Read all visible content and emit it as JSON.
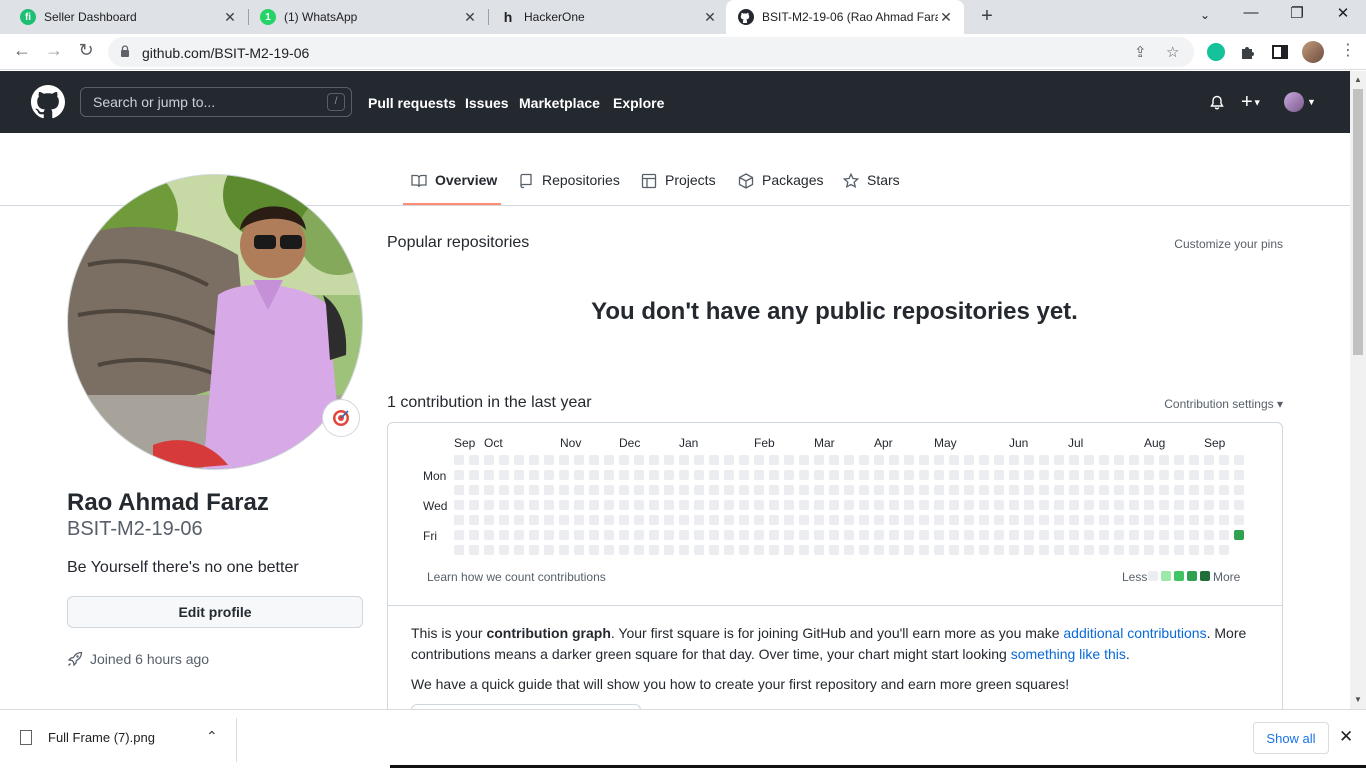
{
  "browser": {
    "tabs": [
      {
        "title": "Seller Dashboard",
        "favicon": "fiverr-icon",
        "color": "#1dbf73"
      },
      {
        "title": "(1) WhatsApp",
        "favicon": "whatsapp-icon",
        "color": "#25d366"
      },
      {
        "title": "HackerOne",
        "favicon": "hackerone-icon",
        "color": "#222222"
      },
      {
        "title": "BSIT-M2-19-06 (Rao Ahmad Faraz)",
        "favicon": "github-icon",
        "color": "#24292f",
        "active": true
      }
    ],
    "url": "github.com/BSIT-M2-19-06"
  },
  "github_header": {
    "search_placeholder": "Search or jump to...",
    "search_shortcut": "/",
    "nav": [
      "Pull requests",
      "Issues",
      "Marketplace",
      "Explore"
    ]
  },
  "profile_tabs": [
    "Overview",
    "Repositories",
    "Projects",
    "Packages",
    "Stars"
  ],
  "profile": {
    "name": "Rao Ahmad Faraz",
    "login": "BSIT-M2-19-06",
    "bio": "Be Yourself there's no one better",
    "edit_label": "Edit profile",
    "joined": "Joined 6 hours ago"
  },
  "overview": {
    "popular_title": "Popular repositories",
    "customize": "Customize your pins",
    "no_repos": "You don't have any public repositories yet.",
    "contrib_title": "1 contribution in the last year",
    "contrib_settings": "Contribution settings ▾",
    "months": [
      "Sep",
      "Oct",
      "Nov",
      "Dec",
      "Jan",
      "Feb",
      "Mar",
      "Apr",
      "May",
      "Jun",
      "Jul",
      "Aug",
      "Sep"
    ],
    "days": [
      "Mon",
      "Wed",
      "Fri"
    ],
    "weeks": 53,
    "contribution_day": {
      "week": 53,
      "weekday": "Fri",
      "count": 1
    },
    "learn_link": "Learn how we count contributions",
    "legend_less": "Less",
    "legend_more": "More",
    "legend_colors": [
      "#ebedf0",
      "#9be9a8",
      "#40c463",
      "#30a14e",
      "#216e39"
    ],
    "explain_1": "This is your ",
    "explain_bold": "contribution graph",
    "explain_2": ". Your first square is for joining GitHub and you'll earn more as you make ",
    "explain_link1": "additional contributions",
    "explain_3": ". More contributions means a darker green square for that day. Over time, your chart might start looking ",
    "explain_link2": "something like this",
    "explain_4": ".",
    "guide": "We have a quick guide that will show you how to create your first repository and earn more green squares!"
  },
  "download_bar": {
    "file": "Full Frame (7).png",
    "show_all": "Show all"
  }
}
